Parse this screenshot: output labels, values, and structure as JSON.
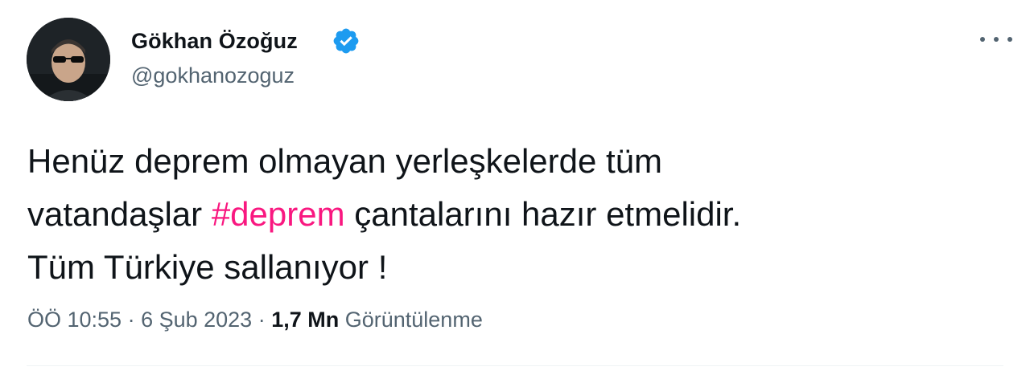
{
  "author": {
    "display_name": "Gökhan Özoğuz",
    "handle": "@gokhanozoguz",
    "verified": true
  },
  "tweet": {
    "text_part1": "Henüz deprem olmayan yerleşkelerde tüm\nvatandaşlar ",
    "hashtag": "#deprem",
    "text_part2": " çantalarını hazır etmelidir.\nTüm Türkiye sallanıyor !"
  },
  "meta": {
    "time": "ÖÖ 10:55",
    "separator": " · ",
    "date": "6 Şub 2023",
    "views_count": "1,7 Mn",
    "views_label": " Görüntülenme"
  },
  "colors": {
    "verified": "#1d9bf0",
    "hashtag": "#f91880",
    "secondary_text": "#536471"
  },
  "icons": [
    "verified-badge-icon",
    "more-options-icon"
  ]
}
